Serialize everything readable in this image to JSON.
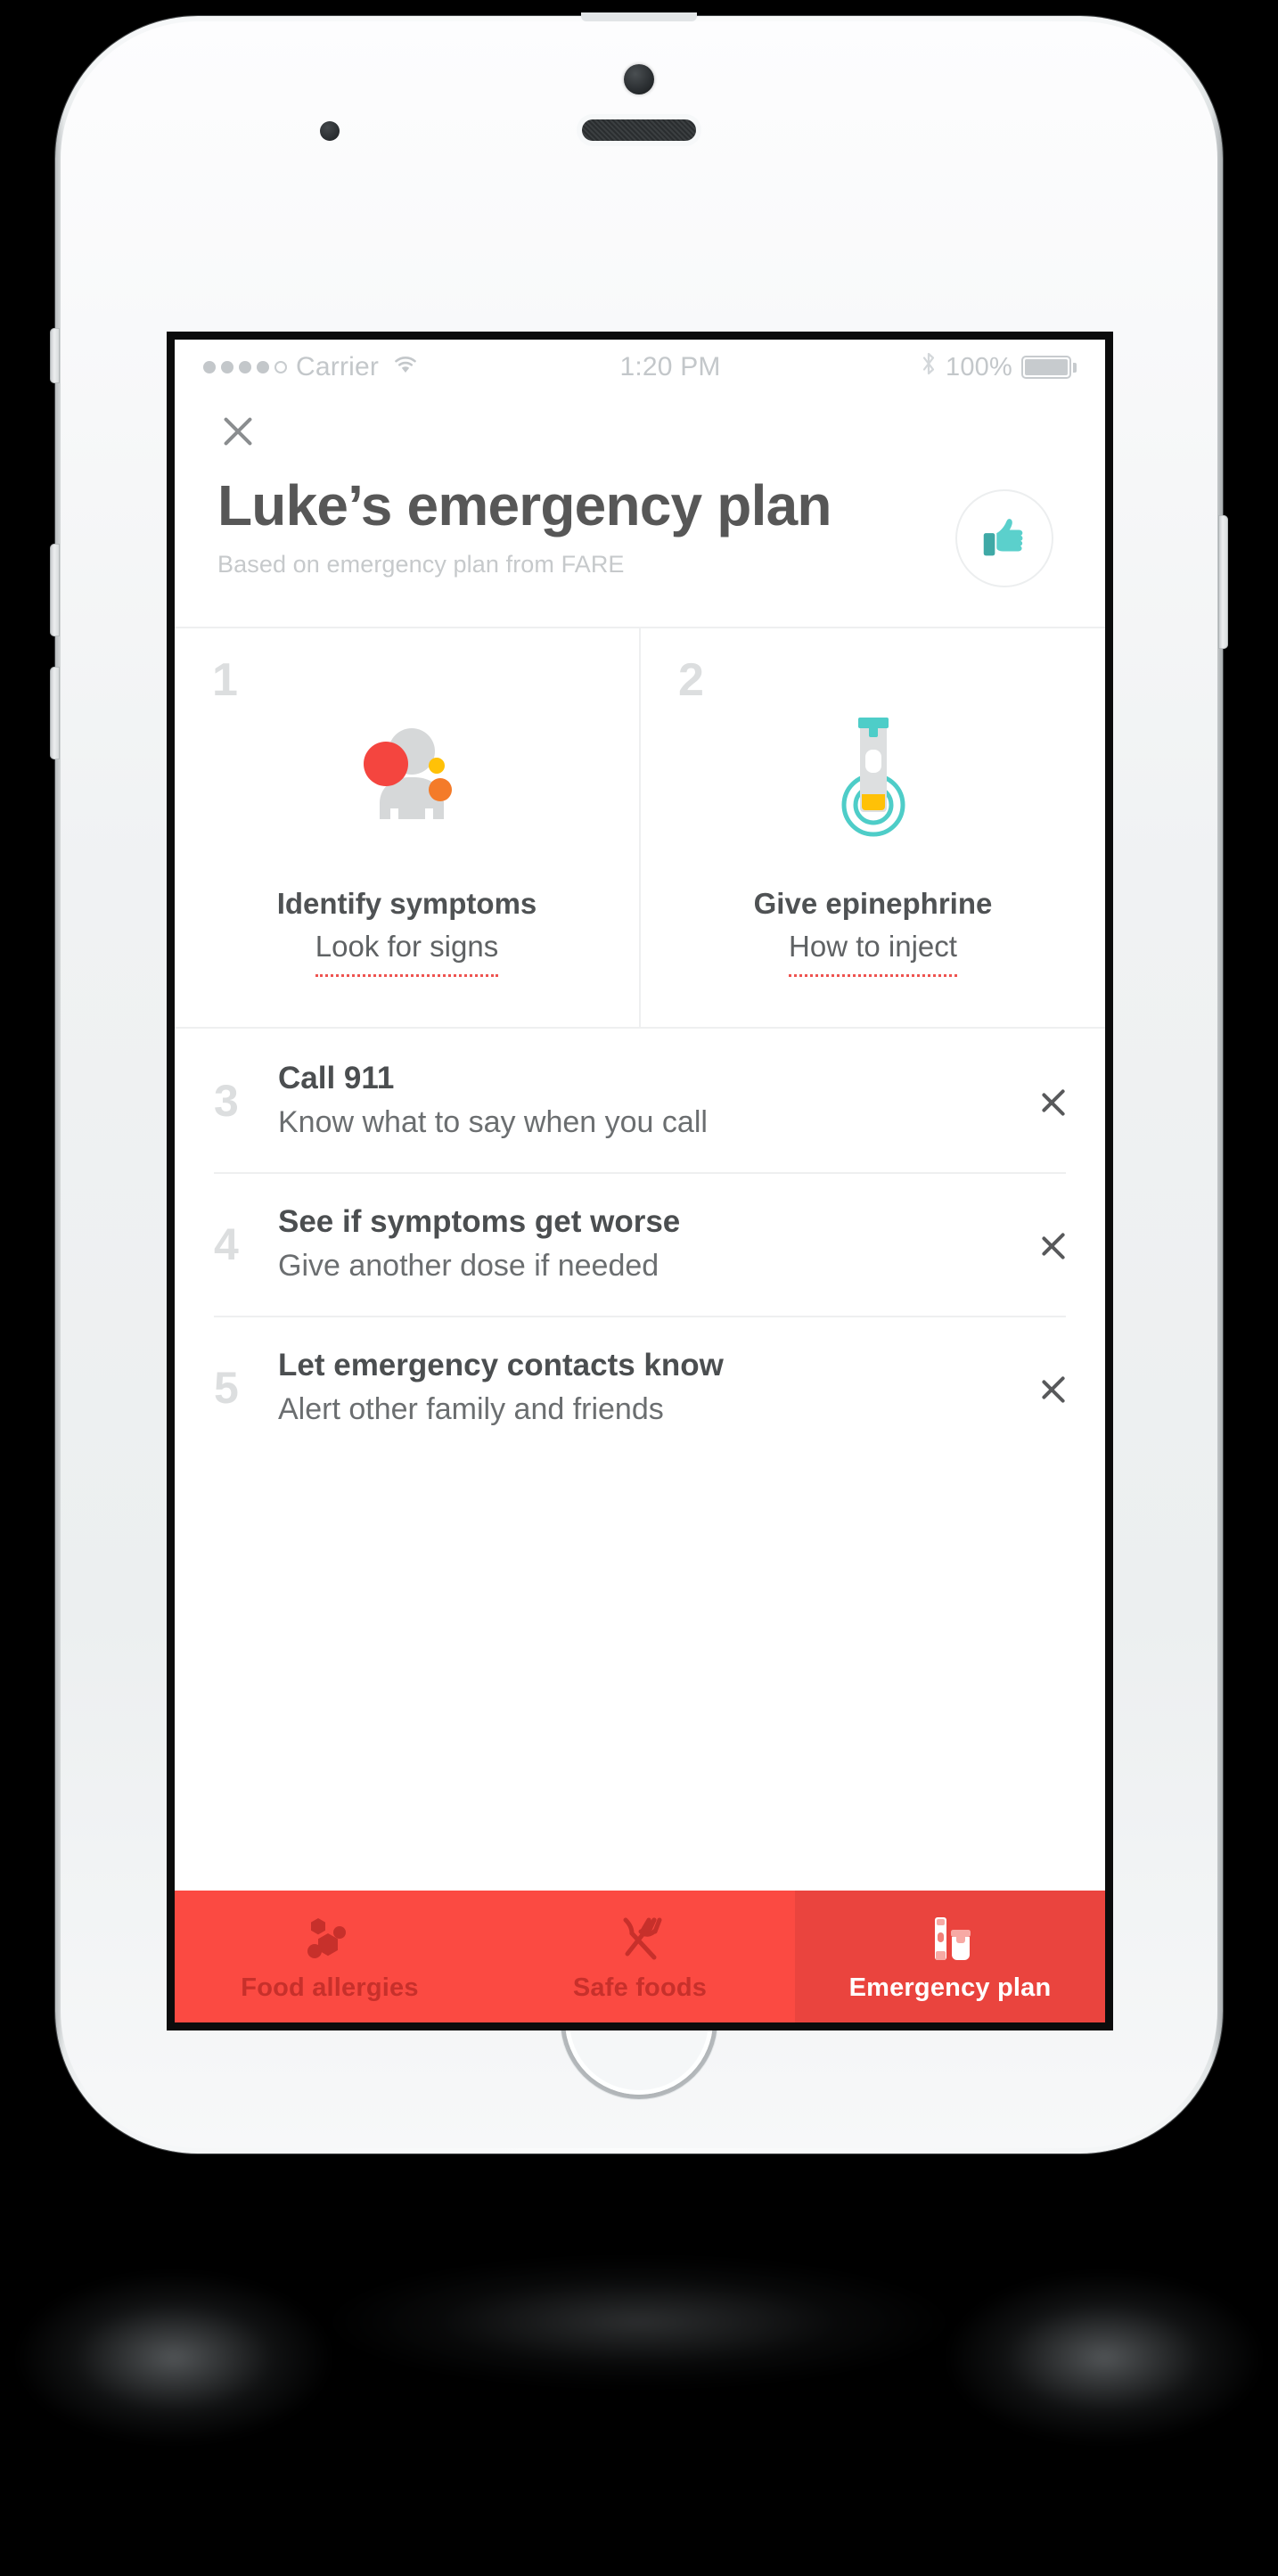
{
  "status_bar": {
    "carrier": "Carrier",
    "signal_dots_filled": 4,
    "signal_dots_total": 5,
    "wifi_icon": "wifi-icon",
    "time": "1:20 PM",
    "bluetooth_icon": "bluetooth-icon",
    "battery_percent": "100%",
    "battery_level": 100
  },
  "header": {
    "close_icon": "close-icon",
    "title": "Luke’s emergency plan",
    "subtitle": "Based on emergency plan from FARE",
    "badge_icon": "thumbs-up-icon"
  },
  "cards": [
    {
      "number": "1",
      "title": "Identify symptoms",
      "link": "Look for signs",
      "art": "person-with-reaction-spots-icon"
    },
    {
      "number": "2",
      "title": "Give epinephrine",
      "link": "How to inject",
      "art": "epinephrine-auto-injector-icon"
    }
  ],
  "steps": [
    {
      "number": "3",
      "title": "Call 911",
      "subtitle": "Know what to say when you call",
      "chevron_icon": "chevron-right-icon"
    },
    {
      "number": "4",
      "title": "See if symptoms get worse",
      "subtitle": "Give another dose if needed",
      "chevron_icon": "chevron-right-icon"
    },
    {
      "number": "5",
      "title": "Let emergency contacts know",
      "subtitle": "Alert other family and friends",
      "chevron_icon": "chevron-right-icon"
    }
  ],
  "tabs": [
    {
      "label": "Food allergies",
      "icon": "allergen-molecule-icon",
      "active": false
    },
    {
      "label": "Safe foods",
      "icon": "fork-knife-icon",
      "active": false
    },
    {
      "label": "Emergency plan",
      "icon": "epipen-case-icon",
      "active": true
    }
  ],
  "colors": {
    "tab_bar": "#FB4A42",
    "tab_bar_active": "#EA443E",
    "tab_label_inactive": "#C7302B",
    "accent_teal": "#4ECDC8",
    "accent_red": "#F4453F",
    "accent_yellow": "#FFC107",
    "accent_orange": "#F47B29",
    "dotted_underline": "#EF5350",
    "title_gray": "#575757",
    "muted_gray": "#C6C9CB"
  }
}
